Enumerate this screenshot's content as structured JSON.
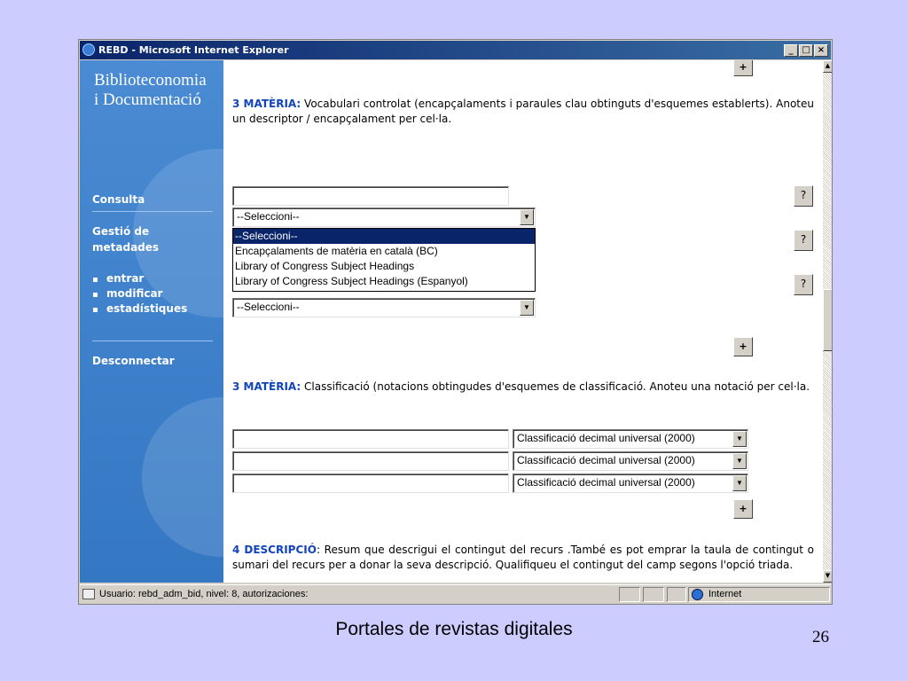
{
  "window": {
    "title": "REBD - Microsoft Internet Explorer",
    "buttons": [
      "_",
      "□",
      "×"
    ]
  },
  "sidebar": {
    "brand_line1": "Biblioteconomia",
    "brand_line2": "i Documentació",
    "consulta": "Consulta",
    "gestio_line1": "Gestió de",
    "gestio_line2": "metadades",
    "sub_items": [
      "entrar",
      "modificar",
      "estadístiques"
    ],
    "desconnectar": "Desconnectar"
  },
  "section_materia_vocab": {
    "heading": "3 MATÈRIA:",
    "text": " Vocabulari controlat (encapçalaments i paraules clau obtinguts d'esquemes establerts). Anoteu un descriptor / encapçalament per cel·la."
  },
  "help_button_label": "?",
  "plus_button_label": "+",
  "select_default": "--Seleccioni--",
  "dropdown_options": [
    "--Seleccioni--",
    "Encapçalaments de matèria en català (BC)",
    "Library of Congress Subject Headings",
    "Library of Congress Subject Headings (Espanyol)"
  ],
  "section_materia_class": {
    "heading": "3 MATÈRIA:",
    "text": " Classificació (notacions obtingudes d'esquemes de classificació. Anoteu una notació per cel·la."
  },
  "classification_select": "Classificació decimal universal (2000)",
  "section_descripcio": {
    "heading": "4 DESCRIPCIÓ",
    "text": ": Resum que descrigui el contingut del recurs .També es pot emprar la taula de contingut o sumari del recurs per a donar la seva descripció. Qualifiqueu el contingut del camp segons l'opció triada."
  },
  "statusbar": {
    "text": "Usuario: rebd_adm_bid, nivel: 8, autorizaciones:",
    "zone": "Internet"
  },
  "slide": {
    "caption": "Portales de revistas digitales",
    "page_number": "26"
  }
}
